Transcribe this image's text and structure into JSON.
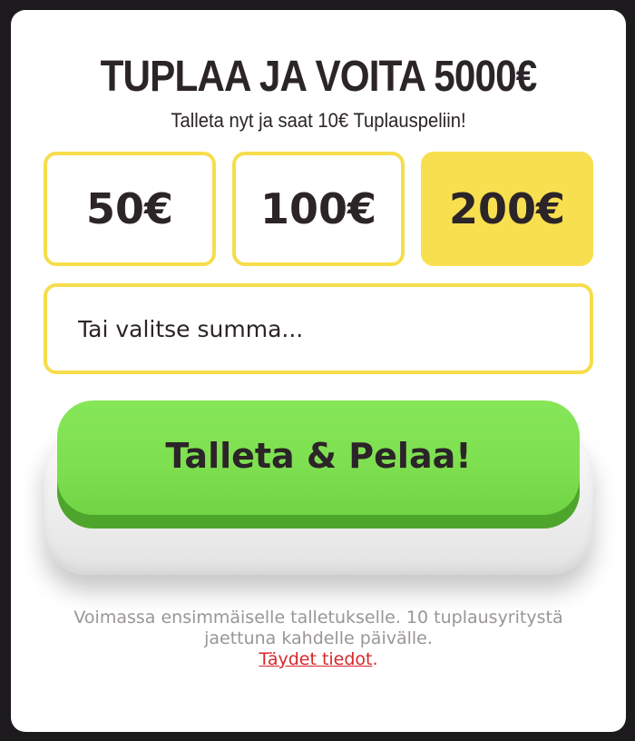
{
  "promo": {
    "title": "TUPLAA JA VOITA 5000€",
    "subtitle": "Talleta nyt ja saat 10€ Tuplauspeliin!"
  },
  "amounts": [
    {
      "label": "50€",
      "selected": false
    },
    {
      "label": "100€",
      "selected": false
    },
    {
      "label": "200€",
      "selected": true
    }
  ],
  "custom_amount": {
    "placeholder": "Tai valitse summa...",
    "value": ""
  },
  "cta": {
    "label": "Talleta & Pelaa!"
  },
  "terms": {
    "line1": "Voimassa ensimmäiselle talletukselle. 10 tuplausyritystä",
    "line2": "jaettuna kahdelle päivälle.",
    "link_label": "Täydet tiedot",
    "after_link": "."
  },
  "colors": {
    "accent_yellow": "#f8df4f",
    "button_green": "#7ddf4f",
    "link_red": "#d8262a",
    "text_dark": "#2b2428"
  }
}
